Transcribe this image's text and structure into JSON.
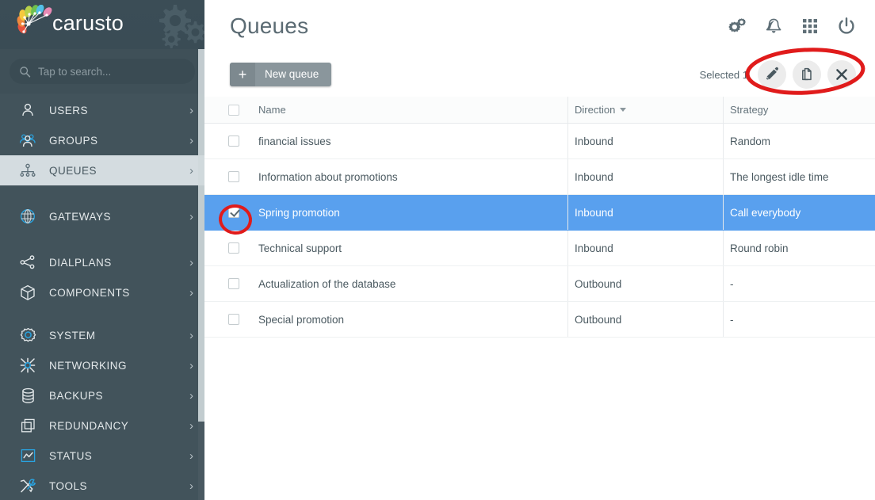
{
  "brand": {
    "name": "carusto",
    "logo_icon": "carusto-fan-logo",
    "header_decor_icon": "gears-icon"
  },
  "search": {
    "placeholder": "Tap to search...",
    "value": "",
    "icon": "search-icon"
  },
  "sidebar": {
    "items": [
      {
        "label": "USERS",
        "icon": "user-icon",
        "active": false,
        "gap_after": false
      },
      {
        "label": "GROUPS",
        "icon": "group-icon",
        "active": false,
        "gap_after": false
      },
      {
        "label": "QUEUES",
        "icon": "queue-tree-icon",
        "active": true,
        "gap_after": true
      },
      {
        "label": "GATEWAYS",
        "icon": "globe-icon",
        "active": false,
        "gap_after": true
      },
      {
        "label": "DIALPLANS",
        "icon": "share-nodes-icon",
        "active": false,
        "gap_after": false
      },
      {
        "label": "COMPONENTS",
        "icon": "cube-icon",
        "active": false,
        "gap_after": true
      },
      {
        "label": "SYSTEM",
        "icon": "gear-outline-icon",
        "active": false,
        "gap_after": false
      },
      {
        "label": "NETWORKING",
        "icon": "network-icon",
        "active": false,
        "gap_after": false
      },
      {
        "label": "BACKUPS",
        "icon": "database-icon",
        "active": false,
        "gap_after": false
      },
      {
        "label": "REDUNDANCY",
        "icon": "copy-squares-icon",
        "active": false,
        "gap_after": false
      },
      {
        "label": "STATUS",
        "icon": "chart-line-icon",
        "active": false,
        "gap_after": false
      },
      {
        "label": "TOOLS",
        "icon": "tools-icon",
        "active": false,
        "gap_after": false
      }
    ],
    "chevron": "›"
  },
  "header": {
    "title": "Queues",
    "icons": [
      {
        "name": "settings-gears-icon"
      },
      {
        "name": "bell-icon"
      },
      {
        "name": "apps-grid-icon"
      },
      {
        "name": "power-icon"
      }
    ]
  },
  "toolbar": {
    "new_button_label": "New queue",
    "new_button_plus": "+",
    "selected_label": "Selected 1",
    "actions": [
      {
        "name": "edit-button",
        "icon": "pencil-icon"
      },
      {
        "name": "copy-button",
        "icon": "copy-icon"
      },
      {
        "name": "delete-button",
        "icon": "close-x-icon"
      }
    ]
  },
  "table": {
    "columns": [
      "Name",
      "Direction",
      "Strategy"
    ],
    "sorted_column": "Direction",
    "sort_direction": "desc",
    "rows": [
      {
        "name": "financial issues",
        "direction": "Inbound",
        "strategy": "Random",
        "selected": false
      },
      {
        "name": "Information about promotions",
        "direction": "Inbound",
        "strategy": "The longest idle time",
        "selected": false
      },
      {
        "name": "Spring promotion",
        "direction": "Inbound",
        "strategy": "Call everybody",
        "selected": true
      },
      {
        "name": "Technical support",
        "direction": "Inbound",
        "strategy": "Round robin",
        "selected": false
      },
      {
        "name": "Actualization of the database",
        "direction": "Outbound",
        "strategy": "-",
        "selected": false
      },
      {
        "name": "Special promotion",
        "direction": "Outbound",
        "strategy": "-",
        "selected": false
      }
    ]
  },
  "annotations": [
    {
      "name": "annotation-toolbar-actions",
      "shape": "ellipse",
      "color": "#e01b1b"
    },
    {
      "name": "annotation-row-checkbox",
      "shape": "ellipse",
      "color": "#e01b1b"
    }
  ],
  "colors": {
    "sidebar_bg": "#42535b",
    "sidebar_header_bg": "#3a4c55",
    "active_item_bg": "#d4dce0",
    "selected_row_bg": "#59a0ee",
    "accent_blue": "#2196f3",
    "annotation_red": "#e01b1b"
  }
}
